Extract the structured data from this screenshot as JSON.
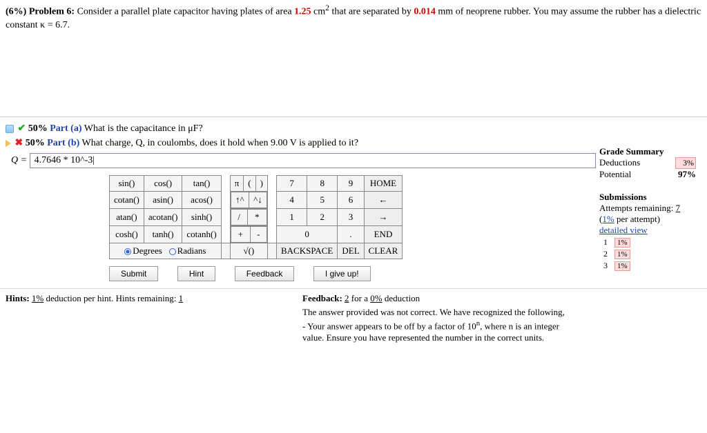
{
  "problem": {
    "weight_label": "(6%)",
    "title": "Problem 6:",
    "text_before_area": "Consider a parallel plate capacitor having plates of area ",
    "area_value": "1.25",
    "area_unit": " cm",
    "area_exp": "2",
    "text_mid": " that are separated by ",
    "sep_value": "0.014",
    "text_after_sep": " mm of neoprene rubber. You may assume the rubber has a dielectric constant κ = 6.7."
  },
  "parts": {
    "a": {
      "pct": "50%",
      "label": "Part (a)",
      "q": "What is the capacitance in μF?"
    },
    "b": {
      "pct": "50%",
      "label": "Part (b)",
      "q": "What charge, Q, in coulombs, does it hold when 9.00 V is applied to it?"
    }
  },
  "answer": {
    "var": "Q =",
    "value": "4.7646 * 10^-3|"
  },
  "grade": {
    "title": "Grade Summary",
    "rows": {
      "ded_label": "Deductions",
      "ded_val": "3%",
      "pot_label": "Potential",
      "pot_val": "97%"
    }
  },
  "subs": {
    "title": "Submissions",
    "attempts": "Attempts remaining: ",
    "attempts_n": "7",
    "per": "(",
    "per_link": "1%",
    "per_tail": " per attempt)",
    "detailed": "detailed view",
    "rows": [
      {
        "n": "1",
        "v": "1%"
      },
      {
        "n": "2",
        "v": "1%"
      },
      {
        "n": "3",
        "v": "1%"
      }
    ]
  },
  "keypad": {
    "r1": [
      "sin()",
      "cos()",
      "tan()"
    ],
    "r2": [
      "cotan()",
      "asin()",
      "acos()"
    ],
    "r3": [
      "atan()",
      "acotan()",
      "sinh()"
    ],
    "r4": [
      "cosh()",
      "tanh()",
      "cotanh()"
    ],
    "mode": {
      "deg": "Degrees",
      "rad": "Radians"
    },
    "sym": {
      "pi": "π",
      "lp": "(",
      "rp": ")",
      "up": "↑^",
      "dn": "^↓",
      "slash": "/",
      "star": "*",
      "plus": "+",
      "minus": "-",
      "sqrt": "√()",
      "dot": "."
    },
    "nums": {
      "7": "7",
      "8": "8",
      "9": "9",
      "4": "4",
      "5": "5",
      "6": "6",
      "1": "1",
      "2": "2",
      "3": "3",
      "0": "0"
    },
    "nav": {
      "home": "HOME",
      "left": "←",
      "right": "→",
      "end": "END",
      "bksp": "BACKSPACE",
      "del": "DEL",
      "clr": "CLEAR"
    }
  },
  "buttons": {
    "submit": "Submit",
    "hint": "Hint",
    "feedback": "Feedback",
    "giveup": "I give up!"
  },
  "hints": {
    "left_a": "Hints: ",
    "left_link": "1%",
    "left_b": " deduction per hint. Hints remaining: ",
    "left_n": "1",
    "fb_a": "Feedback: ",
    "fb_n": "2",
    "fb_b": " for a ",
    "fb_pct": "0%",
    "fb_c": " deduction"
  },
  "feedback_msg": {
    "l1": "The answer provided was not correct. We have recognized the following,",
    "l2": "- Your answer appears to be off by a factor of 10",
    "l2_exp": "n",
    "l2_b": ", where n is an integer value. Ensure you have represented the number in the correct units."
  }
}
